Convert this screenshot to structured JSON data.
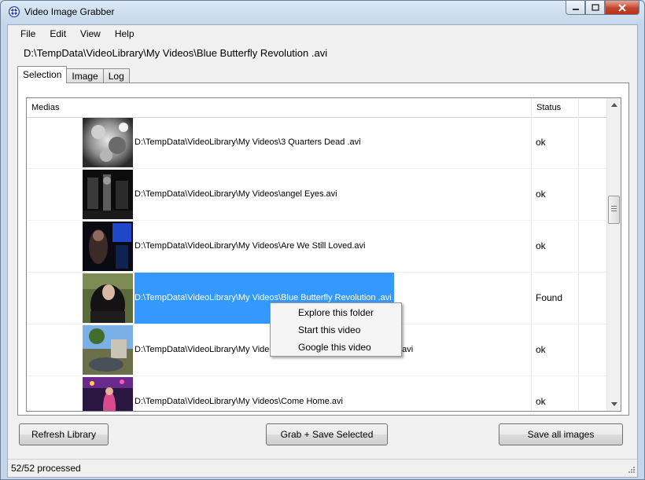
{
  "window": {
    "title": "Video Image Grabber"
  },
  "menu": [
    "File",
    "Edit",
    "View",
    "Help"
  ],
  "current_path": "D:\\TempData\\VideoLibrary\\My Videos\\Blue Butterfly Revolution .avi",
  "tabs": [
    "Selection",
    "Image",
    "Log"
  ],
  "grid": {
    "columns": {
      "media": "Medias",
      "status": "Status"
    },
    "rows": [
      {
        "path": "D:\\TempData\\VideoLibrary\\My Videos\\3 Quarters Dead .avi",
        "status": "ok"
      },
      {
        "path": "D:\\TempData\\VideoLibrary\\My Videos\\angel Eyes.avi",
        "status": "ok"
      },
      {
        "path": "D:\\TempData\\VideoLibrary\\My Videos\\Are We Still Loved.avi",
        "status": "ok"
      },
      {
        "path": "D:\\TempData\\VideoLibrary\\My Videos\\Blue Butterfly Revolution .avi",
        "status": "Found",
        "selected": true
      },
      {
        "path": "D:\\TempData\\VideoLibrary\\My Videos\\",
        "path_tail": "avi",
        "status": "ok"
      },
      {
        "path": "D:\\TempData\\VideoLibrary\\My Videos\\Come Home.avi",
        "status": "ok"
      }
    ]
  },
  "context_menu": [
    "Explore this folder",
    "Start this video",
    "Google this video"
  ],
  "buttons": {
    "refresh": "Refresh Library",
    "grab": "Grab + Save Selected",
    "save_all": "Save all images"
  },
  "status": "52/52 processed",
  "colors": {
    "selection": "#3399ff",
    "close_button": "#c4442a"
  }
}
